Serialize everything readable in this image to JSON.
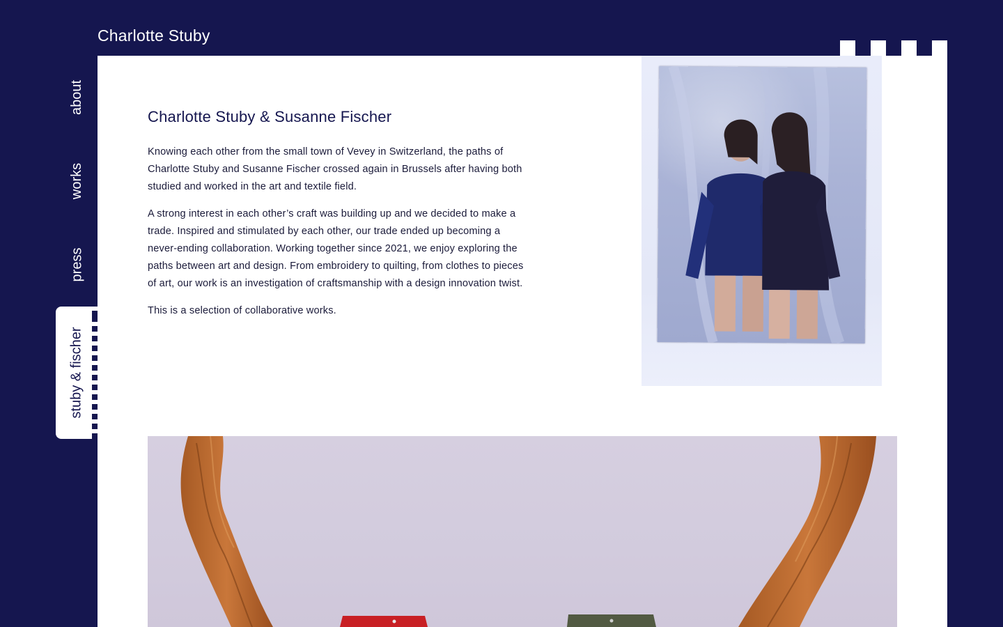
{
  "site": {
    "title": "Charlotte Stuby"
  },
  "nav": {
    "items": [
      {
        "label": "about"
      },
      {
        "label": "works"
      },
      {
        "label": "press"
      },
      {
        "label": "stuby & fischer",
        "active": true
      }
    ]
  },
  "intro": {
    "heading": "Charlotte Stuby & Susanne Fischer",
    "paragraphs": [
      "Knowing each other from the small town of Vevey in Switzerland, the paths of Charlotte Stuby and Susanne Fischer crossed again in Brussels after having both studied and worked in the art and textile field.",
      "A strong interest in each other’s craft was building up and we decided to make a trade. Inspired and stimulated by each other, our trade ended up becoming a never-ending collaboration. Working together since 2021, we enjoy exploring the paths between art and design. From embroidery to quilting, from clothes to pieces of art, our work is an investigation of craftsmanship with a design innovation twist.",
      "This is a selection of collaborative works."
    ]
  },
  "colors": {
    "background": "#15164f",
    "panel": "#ffffff",
    "text": "#1b1b3a"
  }
}
